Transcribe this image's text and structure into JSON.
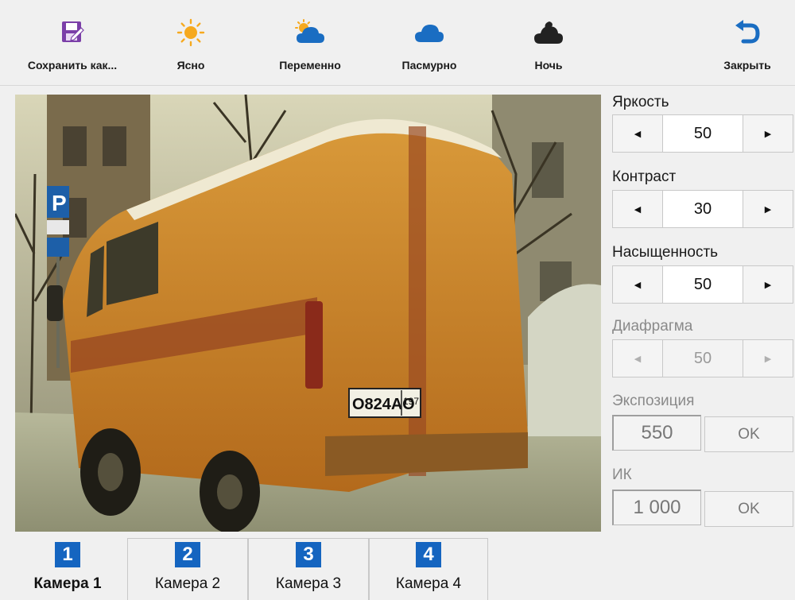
{
  "toolbar": {
    "save_as": "Сохранить как...",
    "clear": "Ясно",
    "partly": "Переменно",
    "cloudy": "Пасмурно",
    "night": "Ночь",
    "close": "Закрыть"
  },
  "icons": {
    "save_as": "save-as-icon",
    "clear": "sun-icon",
    "partly": "sun-cloud-icon",
    "cloudy": "cloud-icon",
    "night": "night-cloud-icon",
    "close": "undo-arrow-icon"
  },
  "camera_view": {
    "plate": "О824АО",
    "plate_region": "197"
  },
  "settings": {
    "brightness": {
      "label": "Яркость",
      "value": "50"
    },
    "contrast": {
      "label": "Контраст",
      "value": "30"
    },
    "saturation": {
      "label": "Насыщенность",
      "value": "50"
    },
    "iris": {
      "label": "Диафрагма",
      "value": "50",
      "disabled": true
    },
    "exposure": {
      "label": "Экспозиция",
      "value": "550",
      "ok": "OK",
      "disabled": true
    },
    "ir": {
      "label": "ИК",
      "value": "1 000",
      "ok": "OK",
      "disabled": true
    }
  },
  "tabs": [
    {
      "num": "1",
      "label": "Камера 1",
      "active": true
    },
    {
      "num": "2",
      "label": "Камера 2",
      "active": false
    },
    {
      "num": "3",
      "label": "Камера 3",
      "active": false
    },
    {
      "num": "4",
      "label": "Камера 4",
      "active": false
    }
  ],
  "colors": {
    "accent": "#1565c0",
    "icon_blue": "#1a6dc2",
    "save_icon": "#7b3fa8",
    "sun": "#f6a91e",
    "night_cloud": "#222222"
  }
}
